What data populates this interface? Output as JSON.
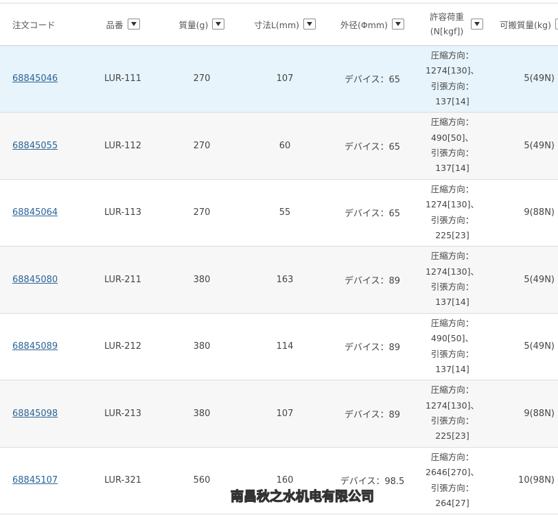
{
  "headers": {
    "code": "注文コード",
    "part": "品番",
    "mass": "質量(g)",
    "length": "寸法L(mm)",
    "diameter": "外径(Φmm)",
    "allow_line1": "許容荷重",
    "allow_line2": "(N[kgf])",
    "load": "可搬質量(kg)"
  },
  "rows": [
    {
      "code": "68845046",
      "part": "LUR-111",
      "mass": "270",
      "length": "107",
      "diameter": "デバイス：65",
      "allow": [
        "圧縮方向：",
        "1274[130]、",
        "引張方向：",
        "137[14]"
      ],
      "load": "5(49N)"
    },
    {
      "code": "68845055",
      "part": "LUR-112",
      "mass": "270",
      "length": "60",
      "diameter": "デバイス：65",
      "allow": [
        "圧縮方向：",
        "490[50]、",
        "引張方向：",
        "137[14]"
      ],
      "load": "5(49N)"
    },
    {
      "code": "68845064",
      "part": "LUR-113",
      "mass": "270",
      "length": "55",
      "diameter": "デバイス：65",
      "allow": [
        "圧縮方向：",
        "1274[130]、",
        "引張方向：",
        "225[23]"
      ],
      "load": "9(88N)"
    },
    {
      "code": "68845080",
      "part": "LUR-211",
      "mass": "380",
      "length": "163",
      "diameter": "デバイス：89",
      "allow": [
        "圧縮方向：",
        "1274[130]、",
        "引張方向：",
        "137[14]"
      ],
      "load": "5(49N)"
    },
    {
      "code": "68845089",
      "part": "LUR-212",
      "mass": "380",
      "length": "114",
      "diameter": "デバイス：89",
      "allow": [
        "圧縮方向：",
        "490[50]、",
        "引張方向：",
        "137[14]"
      ],
      "load": "5(49N)"
    },
    {
      "code": "68845098",
      "part": "LUR-213",
      "mass": "380",
      "length": "107",
      "diameter": "デバイス：89",
      "allow": [
        "圧縮方向：",
        "1274[130]、",
        "引張方向：",
        "225[23]"
      ],
      "load": "9(88N)"
    },
    {
      "code": "68845107",
      "part": "LUR-321",
      "mass": "560",
      "length": "160",
      "diameter": "デバイス：98.5",
      "allow": [
        "圧縮方向：",
        "2646[270]、",
        "引張方向：",
        "264[27]"
      ],
      "load": "10(98N)"
    }
  ],
  "watermark": "南昌秋之水机电有限公司",
  "colors": {
    "highlight_row": "#e7f4fb",
    "alt_row": "#f7f7f7",
    "link": "#2a6496"
  }
}
